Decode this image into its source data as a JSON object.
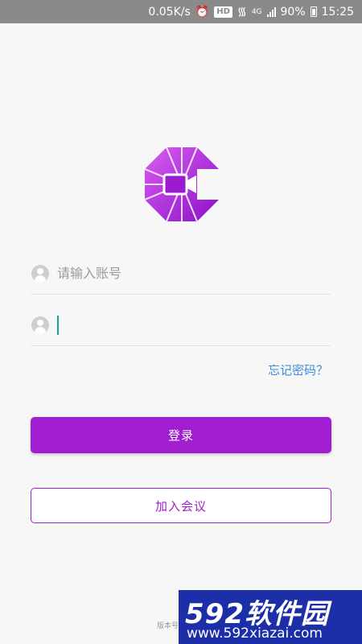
{
  "status_bar": {
    "speed": "0.05K/s",
    "hd": "HD",
    "network": "4G",
    "battery": "90%",
    "time": "15:25"
  },
  "login": {
    "account_placeholder": "请输入账号",
    "password_value": "",
    "forgot_label": "忘记密码？",
    "login_button": "登录",
    "join_button": "加入会议",
    "version_label": "版本号"
  },
  "watermark": {
    "brand": "592软件园",
    "url": "www.592xiazai.com"
  },
  "colors": {
    "accent": "#a01ed0",
    "link": "#3a8ee0",
    "cursor": "#1aa39a"
  }
}
